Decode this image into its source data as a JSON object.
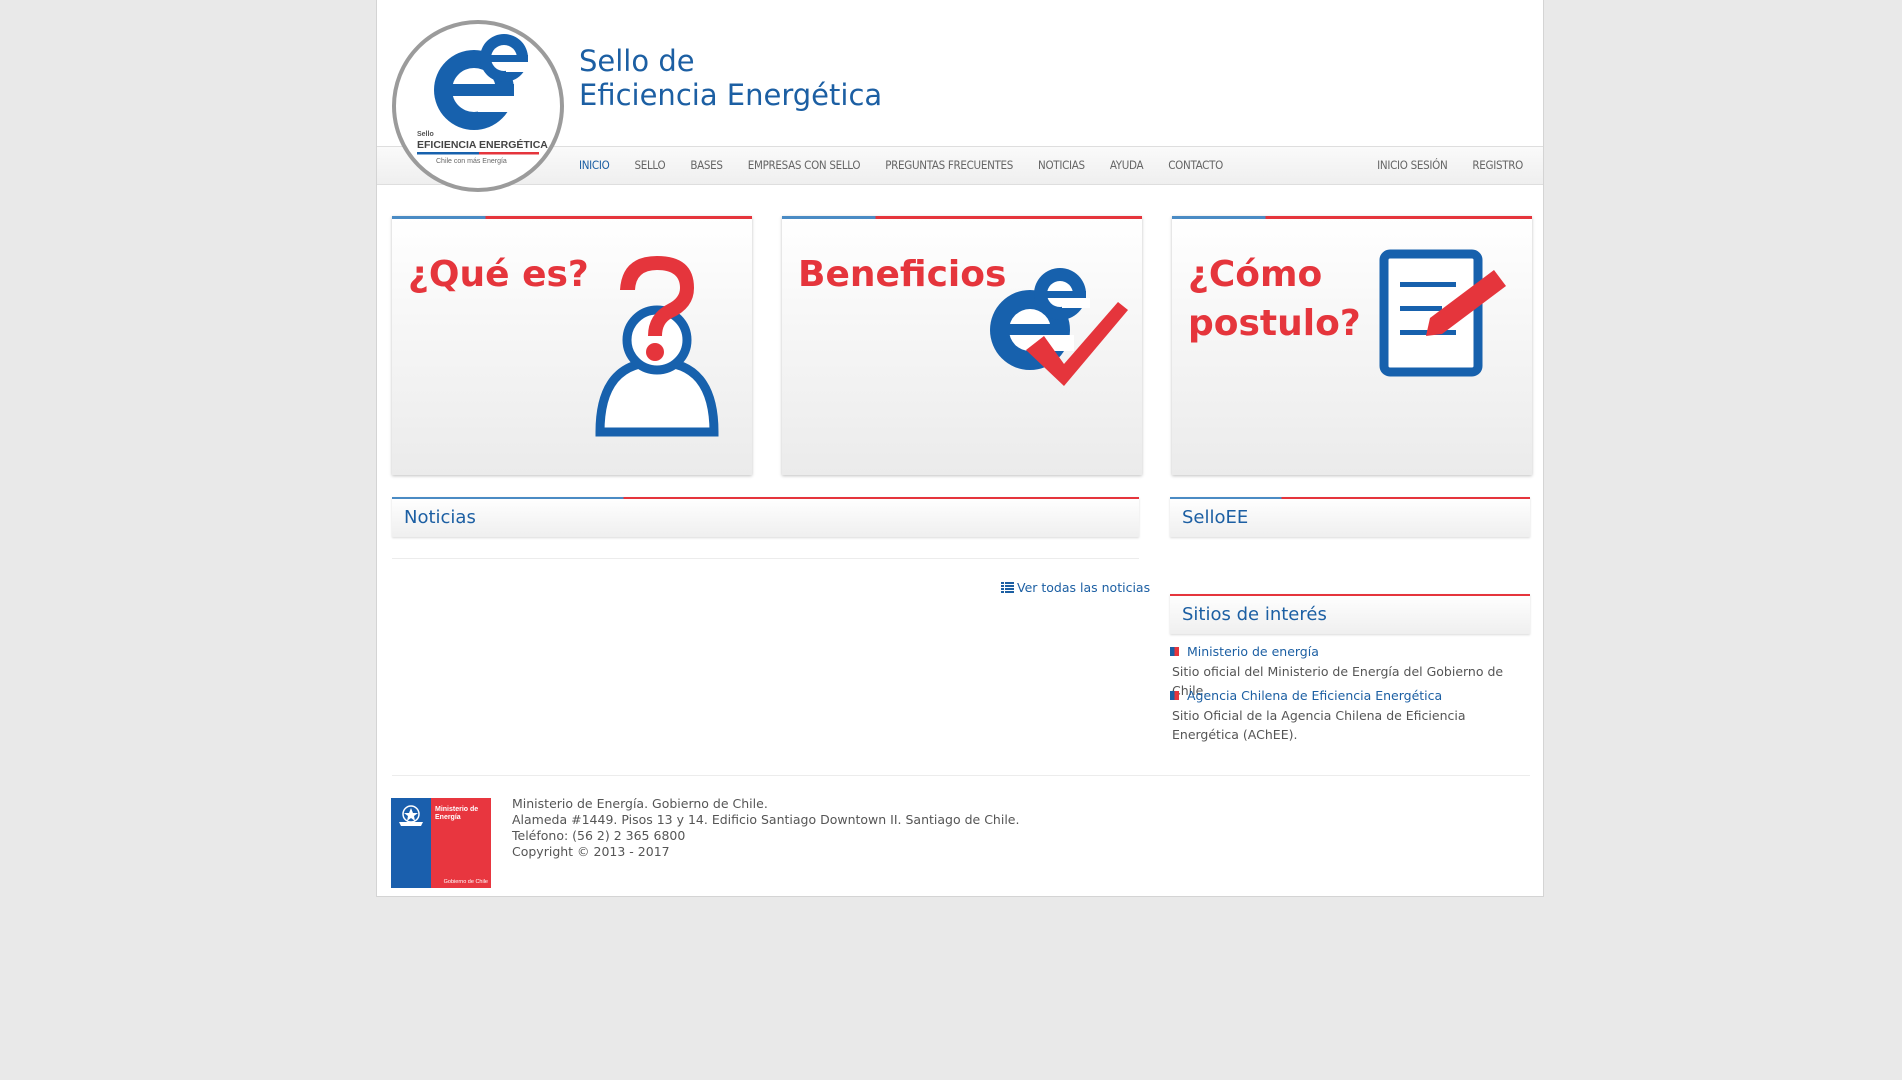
{
  "header": {
    "logo": {
      "top_text": "Sello",
      "main_text": "EFICIENCIA ENERGÉTICA",
      "tagline": "Chile con más Energía"
    },
    "title_line1": "Sello de",
    "title_line2": "Eficiencia Energética"
  },
  "nav": {
    "left_items": [
      "INICIO",
      "SELLO",
      "BASES",
      "EMPRESAS CON SELLO",
      "PREGUNTAS FRECUENTES",
      "NOTICIAS",
      "AYUDA",
      "CONTACTO"
    ],
    "right_items": [
      "INICIO SESIÓN",
      "REGISTRO"
    ],
    "active": "INICIO"
  },
  "cards": [
    {
      "title": "¿Qué es?",
      "icon": "question-person-icon"
    },
    {
      "title": "Beneficios",
      "icon": "ee-check-icon"
    },
    {
      "title_line1": "¿Cómo",
      "title_line2": "postulo?",
      "icon": "form-pencil-icon"
    }
  ],
  "news": {
    "heading": "Noticias",
    "view_all": "Ver todas las noticias"
  },
  "selloee": {
    "heading": "SelloEE"
  },
  "sites": {
    "heading": "Sitios de interés",
    "items": [
      {
        "name": "Ministerio de energía",
        "desc": "Sitio oficial del Ministerio de Energía del Gobierno de Chile."
      },
      {
        "name": "Agencia Chilena de Eficiencia Energética",
        "desc": "Sitio Oficial de la Agencia Chilena de Eficiencia Energética (AChEE)."
      }
    ]
  },
  "footer": {
    "logo_title": "Ministerio de Energía",
    "logo_sub": "Gobierno de Chile",
    "lines": [
      "Ministerio de Energía. Gobierno de Chile.",
      "Alameda #1449. Pisos 13 y 14. Edificio Santiago Downtown II. Santiago de Chile.",
      "Teléfono: (56 2) 2 365 6800",
      "Copyright © 2013 - 2017"
    ]
  },
  "colors": {
    "brand_blue": "#1c5fa3",
    "brand_red": "#e5353c"
  }
}
